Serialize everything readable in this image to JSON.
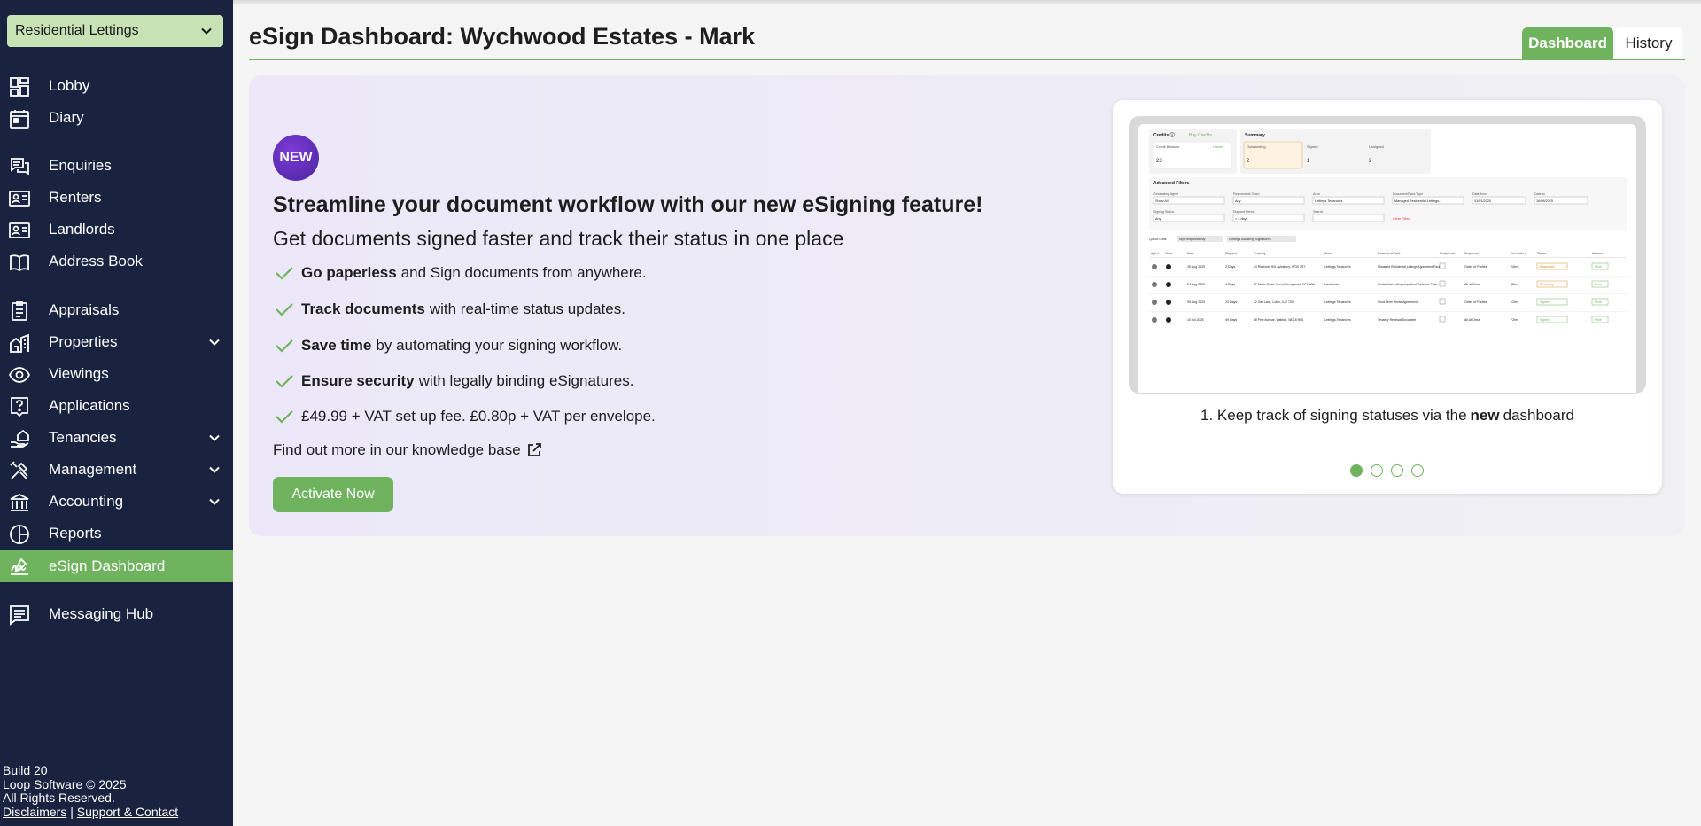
{
  "branch_select": {
    "value": "Residential Lettings"
  },
  "nav": [
    {
      "label": "Lobby",
      "icon": "dashboard-grid-icon"
    },
    {
      "label": "Diary",
      "icon": "calendar-icon"
    },
    {
      "label": "Enquiries",
      "icon": "chat-bubbles-icon"
    },
    {
      "label": "Renters",
      "icon": "contact-card-icon"
    },
    {
      "label": "Landlords",
      "icon": "contact-card-icon"
    },
    {
      "label": "Address Book",
      "icon": "open-book-icon"
    },
    {
      "label": "Appraisals",
      "icon": "clipboard-icon"
    },
    {
      "label": "Properties",
      "icon": "buildings-icon",
      "expandable": true
    },
    {
      "label": "Viewings",
      "icon": "eye-icon"
    },
    {
      "label": "Applications",
      "icon": "question-box-icon"
    },
    {
      "label": "Tenancies",
      "icon": "hand-house-icon",
      "expandable": true
    },
    {
      "label": "Management",
      "icon": "tools-icon",
      "expandable": true
    },
    {
      "label": "Accounting",
      "icon": "bank-icon",
      "expandable": true
    },
    {
      "label": "Reports",
      "icon": "pie-chart-icon"
    },
    {
      "label": "eSign Dashboard",
      "icon": "signature-icon",
      "active": true
    },
    {
      "label": "Messaging Hub",
      "icon": "message-icon"
    }
  ],
  "footer": {
    "build": "Build 20",
    "copyright": "Loop Software © 2025",
    "rights": "All Rights Reserved.",
    "disclaimers": "Disclaimers",
    "separator": "|",
    "support": "Support & Contact"
  },
  "page": {
    "title": "eSign Dashboard: Wychwood Estates - Mark",
    "tabs": {
      "dashboard": "Dashboard",
      "history": "History"
    },
    "active_tab": "Dashboard"
  },
  "promo": {
    "badge": "NEW",
    "headline": "Streamline your document workflow with our new eSigning feature!",
    "subline": "Get documents signed faster and track their status in one place",
    "benefits": [
      {
        "bold": "Go paperless",
        "rest": "and Sign documents from anywhere."
      },
      {
        "bold": "Track documents",
        "rest": "with real-time status updates."
      },
      {
        "bold": "Save time",
        "rest": "by automating your signing workflow."
      },
      {
        "bold": "Ensure security",
        "rest": "with legally binding eSignatures."
      },
      {
        "bold": "",
        "rest": "£49.99 + VAT set up fee. £0.80p + VAT per envelope."
      }
    ],
    "kb_link": "Find out more in our knowledge base",
    "activate_label": "Activate Now"
  },
  "carousel": {
    "caption_before": "1. Keep track of signing statuses via the",
    "caption_bold": "new",
    "caption_after": "dashboard",
    "slide_count": 4,
    "active_slide": 1,
    "screenshot": {
      "credits_title": "Credits ⓘ",
      "buy_credits": "Buy Credits",
      "credit_balance_label": "Credit Balance",
      "history_label": "History",
      "credit_balance": "23",
      "summary_title": "Summary",
      "summary_headers": [
        "Outstanding",
        "Signed",
        "Unsigned"
      ],
      "summary_values": [
        "2",
        "1",
        "2"
      ],
      "filters_title": "Advanced Filters",
      "filter_labels": [
        "Generating Agent",
        "Responsible Team",
        "Area",
        "Document/Pack Type",
        "Date from",
        "Date to"
      ],
      "filter_values": [
        "Show All",
        "Any",
        "Lettings Tenancies",
        "Managed Residential Lettings...",
        "01/01/2025",
        "16/08/2025"
      ],
      "filter_labels2": [
        "Signing Status",
        "Elapsed Period",
        "Search"
      ],
      "filter_values2": [
        "Any",
        "> 3 days",
        ""
      ],
      "clear_filters": "Clear Filters",
      "quick_lists": [
        "Quick Lists",
        "My Responsibility",
        "Lettings Awaiting Signatures"
      ],
      "table_headers": [
        "Agent",
        "Team",
        "Date",
        "Elapsed",
        "Property",
        "Area",
        "Document/Pack",
        "Recipients",
        "Sequence",
        "Reminders",
        "Status",
        "Actions"
      ],
      "rows": [
        [
          "26 Aug 2025",
          "2 Days",
          "13 Rickfords Hill, Aylesbury, HP20 2RT",
          "Lettings Tenancies",
          "Managed Residential Lettings Agreement Pack",
          "Order of Parties",
          "24hrs",
          "Requested",
          "More"
        ],
        [
          "24 Aug 2025",
          "4 Days",
          "47 Maple Road, Hemel Hempstead, HP1 1AA",
          "Landlords",
          "Residential Lettings Landlord Welcome Pack",
          "All at Once",
          "48hrs",
          "1 Pending",
          "More"
        ],
        [
          "05 Aug 2025",
          "23 Days",
          "12 Oak Lane, Luton, LU2 7SQ",
          "Lettings Tenancies",
          "Short-Term Rental Agreement",
          "Order of Parties",
          "12hrs",
          "Signed",
          "More"
        ],
        [
          "10 Jul 2025",
          "49 Days",
          "58 Pine Avenue, Watford, WD18 5ND",
          "Lettings Tenancies",
          "Tenancy Renewal Document",
          "All at Once",
          "72hrs",
          "Signed",
          "More"
        ]
      ]
    }
  },
  "colors": {
    "sidebar_bg": "#192340",
    "accent_green": "#6fb35f",
    "branch_select_bg": "#c7e3b5",
    "badge_purple": "#5a2bb8"
  }
}
